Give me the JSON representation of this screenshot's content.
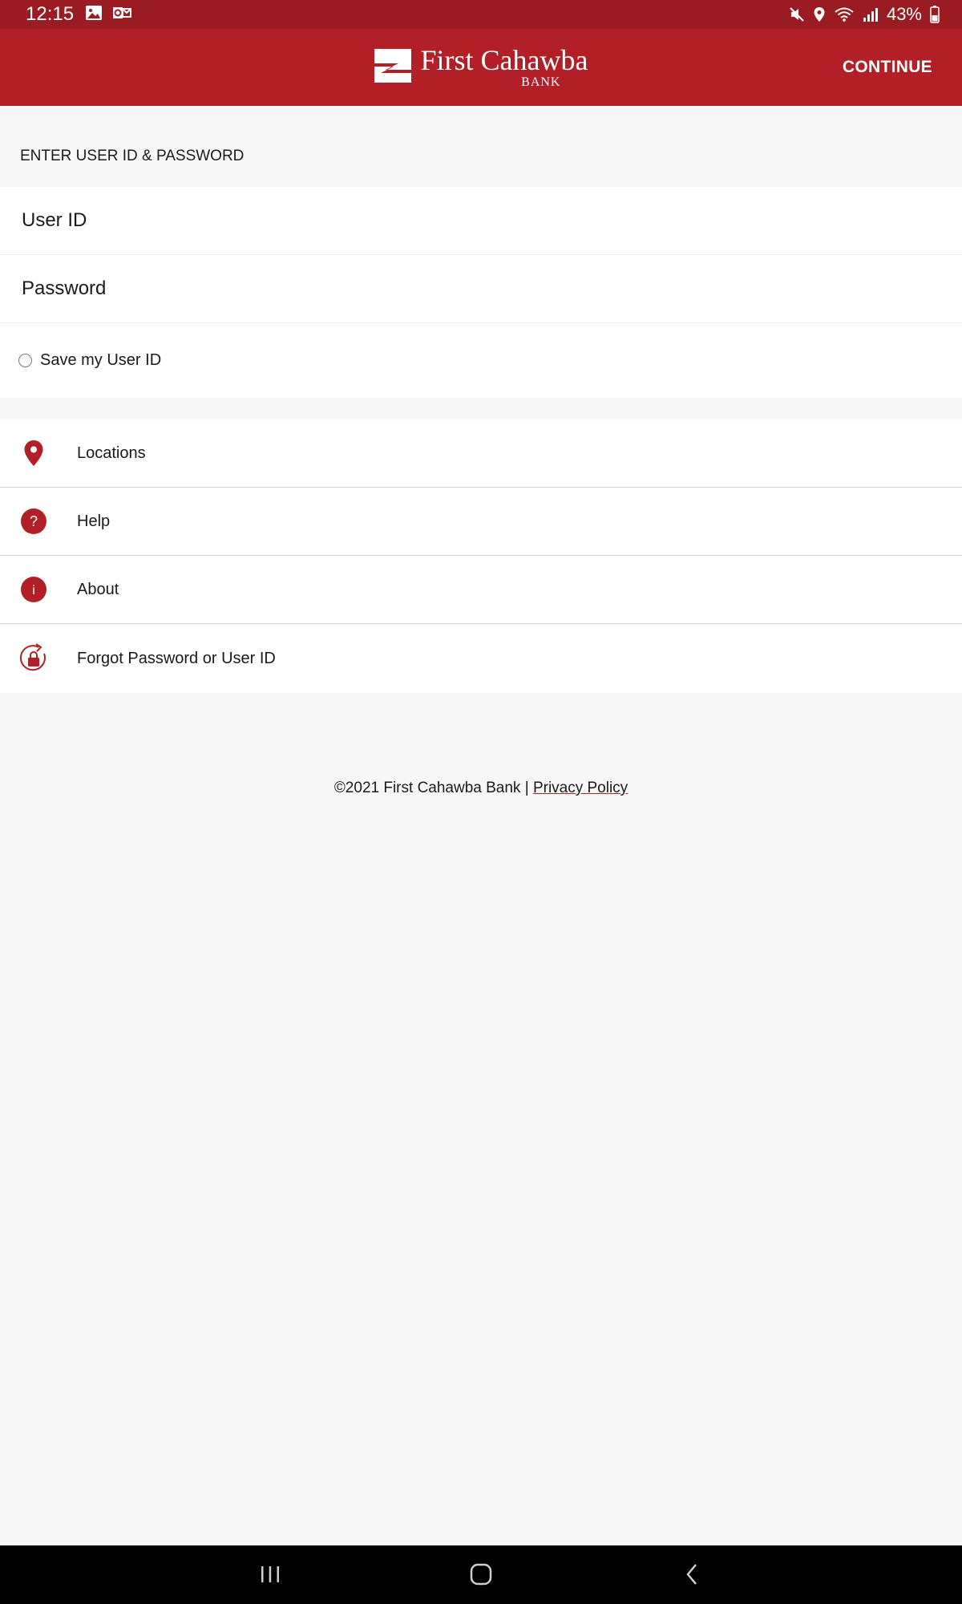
{
  "status_bar": {
    "time": "12:15",
    "battery": "43%"
  },
  "header": {
    "logo_name": "First Cahawba",
    "logo_sub": "BANK",
    "continue_label": "CONTINUE"
  },
  "login": {
    "section_title": "ENTER USER ID & PASSWORD",
    "user_id_placeholder": "User ID",
    "password_placeholder": "Password",
    "save_label": "Save my User ID"
  },
  "menu": {
    "items": [
      {
        "label": "Locations",
        "icon": "location-pin-icon"
      },
      {
        "label": "Help",
        "icon": "question-icon"
      },
      {
        "label": "About",
        "icon": "info-icon"
      },
      {
        "label": "Forgot Password or User ID",
        "icon": "lock-reset-icon"
      }
    ]
  },
  "footer": {
    "copyright": "©2021 First Cahawba Bank | ",
    "privacy_label": "Privacy Policy"
  },
  "colors": {
    "status_bar": "#9b1b22",
    "header": "#b31f27",
    "accent": "#b31f27",
    "background": "#f7f7f7"
  }
}
